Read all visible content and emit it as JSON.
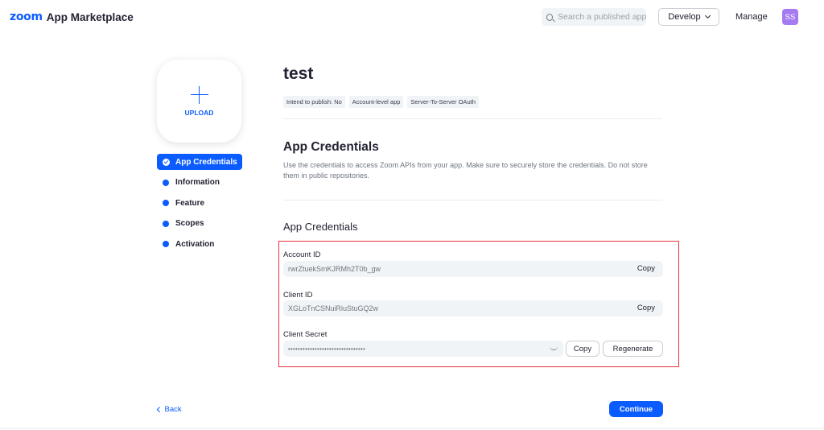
{
  "header": {
    "brand_logo": "zoom",
    "brand_name": "App Marketplace",
    "search_placeholder": "Search a published app",
    "develop_label": "Develop",
    "manage_label": "Manage",
    "avatar_initials": "SS",
    "avatar_color": "#a67bf0"
  },
  "upload": {
    "label": "UPLOAD"
  },
  "nav": {
    "items": [
      {
        "label": "App Credentials",
        "active": true
      },
      {
        "label": "Information"
      },
      {
        "label": "Feature"
      },
      {
        "label": "Scopes"
      },
      {
        "label": "Activation"
      }
    ]
  },
  "app": {
    "title": "test",
    "tags": [
      "Intend to publish: No",
      "Account-level app",
      "Server-To-Server OAuth"
    ]
  },
  "section": {
    "title": "App Credentials",
    "description": "Use the credentials to access Zoom APIs from your app. Make sure to securely store the credentials. Do not store them in public repositories.",
    "subtitle": "App Credentials"
  },
  "credentials": {
    "account_id": {
      "label": "Account ID",
      "value": "rwrZtuekSmKJRMh2T0b_gw",
      "copy_label": "Copy"
    },
    "client_id": {
      "label": "Client ID",
      "value": "XGLoTnCSNuiRiuStuGQ2w",
      "copy_label": "Copy"
    },
    "client_secret": {
      "label": "Client Secret",
      "value": "••••••••••••••••••••••••••••••••",
      "copy_label": "Copy",
      "regenerate_label": "Regenerate"
    }
  },
  "footer": {
    "back_label": "Back",
    "continue_label": "Continue"
  },
  "colors": {
    "accent": "#0b5cff",
    "highlight_border": "#e8323c"
  }
}
